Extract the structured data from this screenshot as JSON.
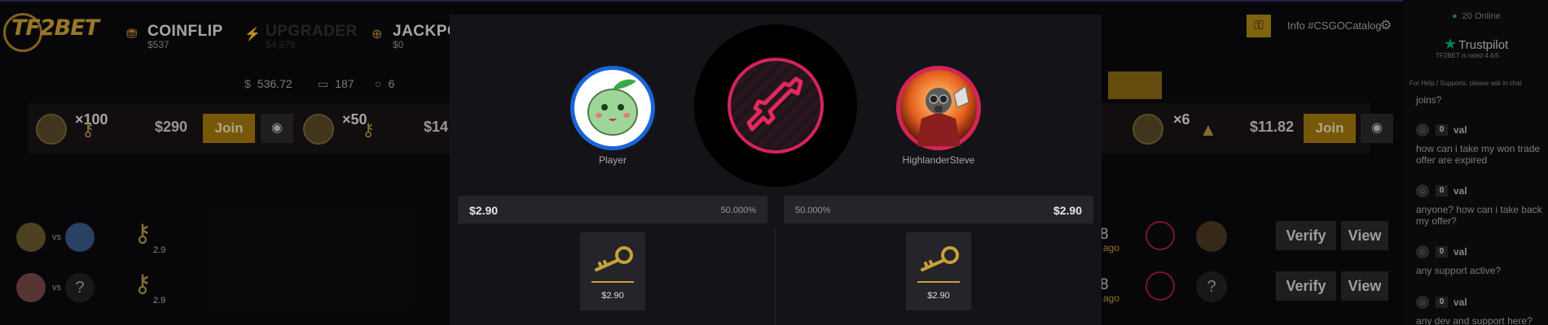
{
  "logo": {
    "text": "TF2BET"
  },
  "nav": [
    {
      "label": "COINFLIP",
      "sub": "$537",
      "icon": "coins-icon"
    },
    {
      "label": "UPGRADER",
      "sub": "$4,976",
      "icon": "bolt-icon"
    },
    {
      "label": "JACKPO",
      "sub": "$0",
      "icon": "target-icon"
    }
  ],
  "stats": [
    {
      "icon": "dollar-icon",
      "glyph": "$",
      "value": "536.72"
    },
    {
      "icon": "inbox-icon",
      "glyph": "▭",
      "value": "187"
    },
    {
      "icon": "circle-icon",
      "glyph": "○",
      "value": "6"
    }
  ],
  "rooms": [
    {
      "mult": "×100",
      "price": "$290",
      "join": "Join"
    },
    {
      "mult": "×50",
      "price": "$14"
    },
    {
      "mult": "×6",
      "price": "$11.82",
      "join": "Join"
    }
  ],
  "games": [
    {
      "vs": "vs",
      "value": "2.9",
      "time": "8",
      "ago": "ago",
      "verify": "Verify",
      "view": "View"
    },
    {
      "vs": "vs",
      "value": "2.9",
      "time": "8",
      "ago": "ago",
      "verify": "Verify",
      "view": "View",
      "q": "?"
    }
  ],
  "header_right": {
    "info": "Info #CSGOCatalog"
  },
  "chat": {
    "online": "20 Online",
    "trustpilot": "Trustpilot",
    "rating": "TF2BET is rated 4.6/5",
    "help": "For Help / Supports, please ask in chat",
    "first_msg": "joins?",
    "messages": [
      {
        "level": "0",
        "name": "val",
        "text": "how can i take my won trade offer are expired"
      },
      {
        "level": "0",
        "name": "val",
        "text": "anyone? how can i take back my offer?"
      },
      {
        "level": "0",
        "name": "val",
        "text": "any support active?"
      },
      {
        "level": "0",
        "name": "val",
        "text": "any dev and support here?"
      }
    ]
  },
  "modal": {
    "left": {
      "name": "Player",
      "amount": "$2.90",
      "pct": "50.000%",
      "item_price": "$2.90"
    },
    "right": {
      "name": "HighlanderSteve",
      "amount": "$2.90",
      "pct": "50.000%",
      "item_price": "$2.90"
    }
  },
  "colors": {
    "accent": "#d4a534",
    "ring": "#d62456",
    "trustpilot": "#00b67a"
  }
}
